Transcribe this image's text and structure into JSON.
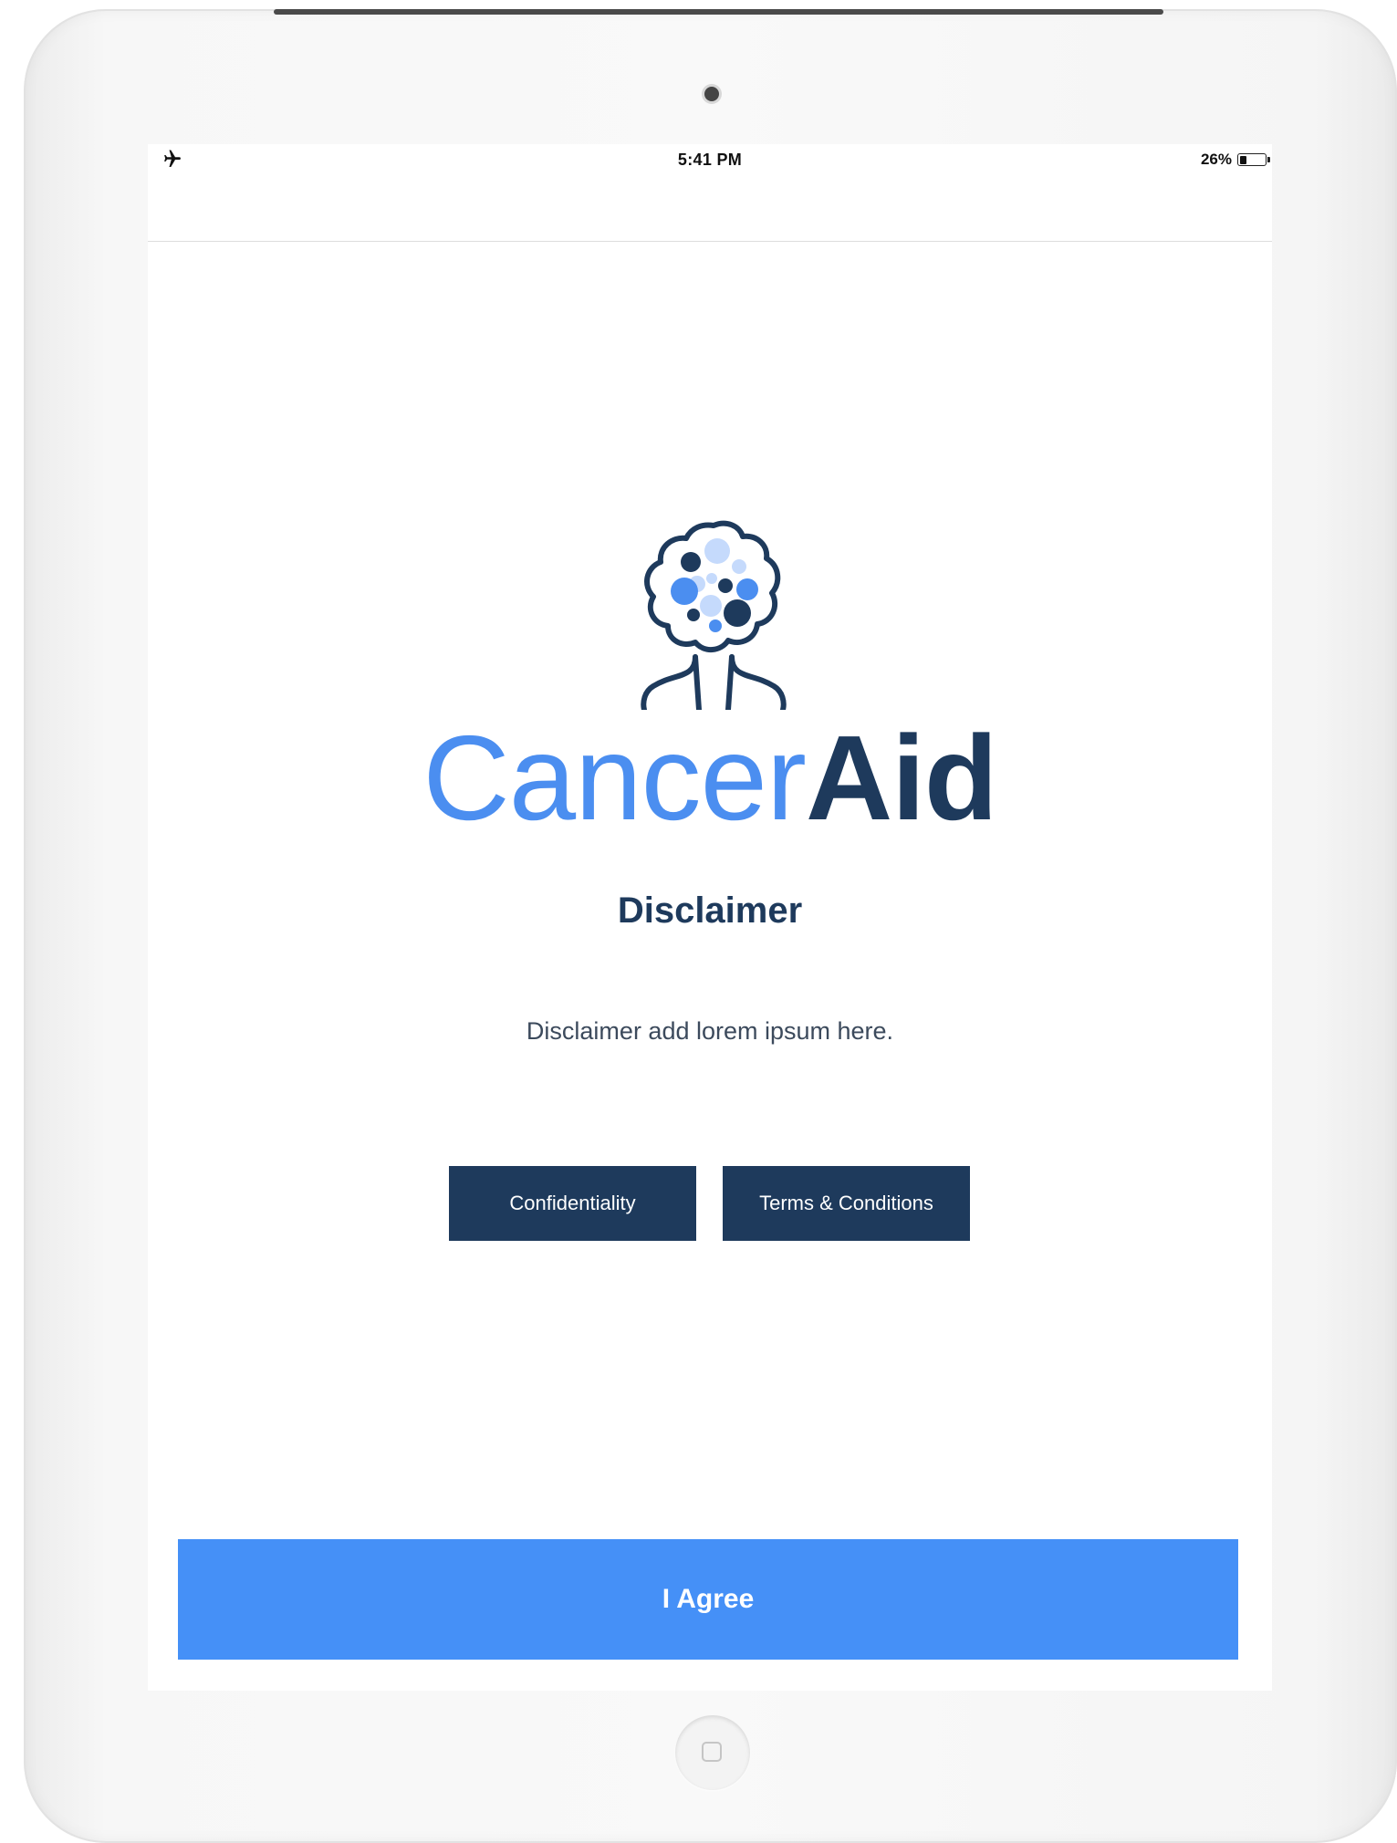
{
  "status_bar": {
    "time": "5:41 PM",
    "battery_percent": "26%",
    "battery_level": 0.26,
    "airplane_mode_icon": "airplane-icon"
  },
  "logo": {
    "icon": "tree-cells-hands-logo",
    "wordmark_light": "Cancer",
    "wordmark_dark": "Aid",
    "colors": {
      "light_blue": "#4b8ef0",
      "pale_blue": "#c5dafc",
      "navy": "#1e3a5c"
    }
  },
  "content": {
    "title": "Disclaimer",
    "body": "Disclaimer add lorem ipsum here."
  },
  "buttons": {
    "confidentiality": "Confidentiality",
    "terms": "Terms & Conditions",
    "agree": "I Agree"
  },
  "colors": {
    "primary_dark": "#1e3a5c",
    "primary_blue": "#4590f7",
    "background": "#ffffff"
  }
}
